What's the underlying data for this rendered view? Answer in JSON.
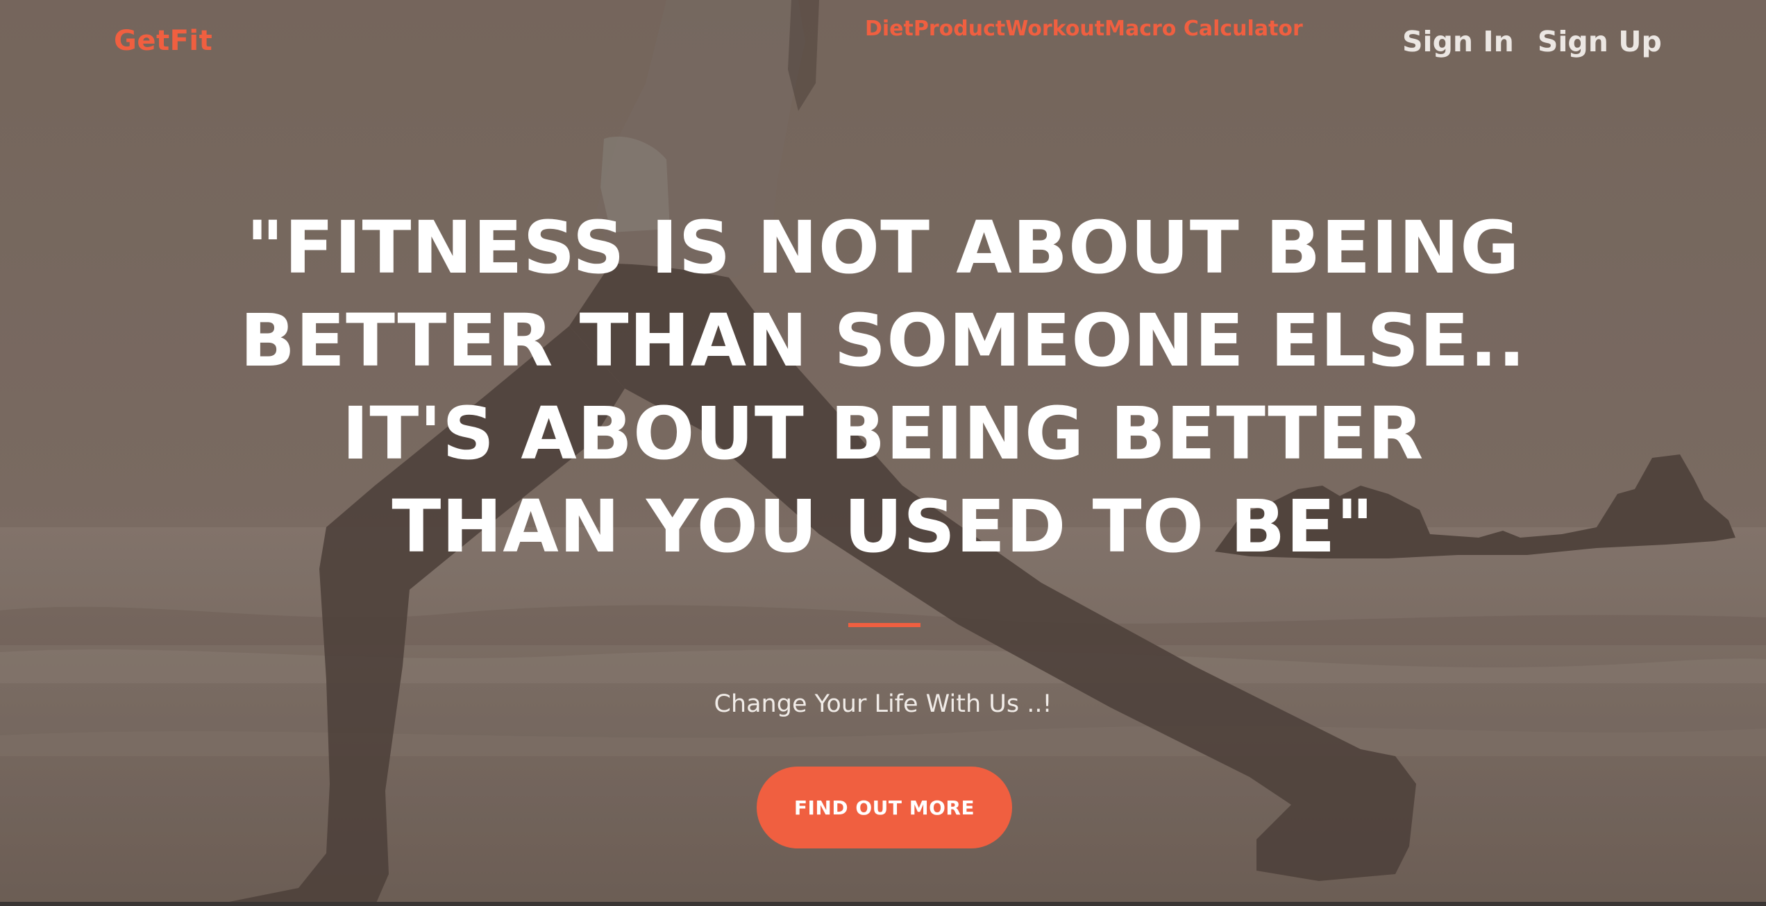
{
  "colors": {
    "accent": "#f05f40",
    "text_light": "#ffffff"
  },
  "navbar": {
    "brand": "GetFit",
    "links": [
      {
        "label": "Diet"
      },
      {
        "label": "Product"
      },
      {
        "label": "Workout"
      },
      {
        "label": "Macro Calculator"
      }
    ],
    "sign_in": "Sign In",
    "sign_up": "Sign Up"
  },
  "hero": {
    "quote_lines": [
      "\"FITNESS IS NOT ABOUT BEING",
      "BETTER THAN SOMEONE ELSE..",
      "IT'S ABOUT BEING BETTER",
      "THAN YOU USED TO BE\""
    ],
    "subtitle": "Change Your Life With Us ..!",
    "cta_label": "FIND OUT MORE"
  }
}
